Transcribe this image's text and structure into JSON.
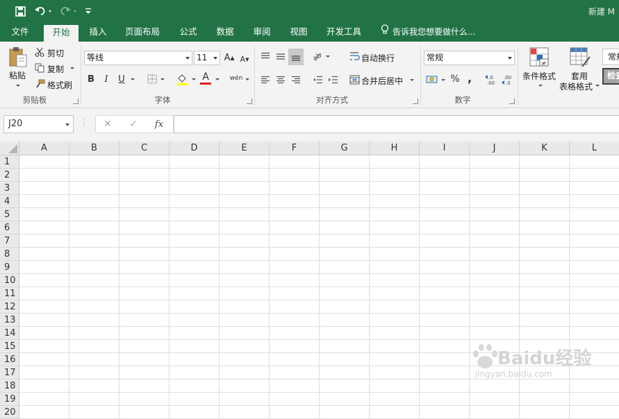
{
  "colors": {
    "brand": "#217346",
    "ribbon_bg": "#f3f3f3",
    "header_bg": "#e9e9e9"
  },
  "title_bar": {
    "title": "新建 M"
  },
  "tabs": [
    {
      "label": "文件",
      "active": false
    },
    {
      "label": "开始",
      "active": true
    },
    {
      "label": "插入",
      "active": false
    },
    {
      "label": "页面布局",
      "active": false
    },
    {
      "label": "公式",
      "active": false
    },
    {
      "label": "数据",
      "active": false
    },
    {
      "label": "审阅",
      "active": false
    },
    {
      "label": "视图",
      "active": false
    },
    {
      "label": "开发工具",
      "active": false
    }
  ],
  "tell_me": "告诉我您想要做什么...",
  "clipboard": {
    "paste": "粘贴",
    "cut": "剪切",
    "copy": "复制",
    "format_painter": "格式刷",
    "label": "剪贴板"
  },
  "font": {
    "name": "等线",
    "size": "11",
    "label": "字体",
    "bold": "B",
    "italic": "I",
    "underline": "U",
    "grow": "A",
    "shrink": "A",
    "font_color": "A",
    "phonetic": "wén"
  },
  "alignment": {
    "wrap_text": "自动换行",
    "merge_center": "合并后居中",
    "label": "对齐方式"
  },
  "number": {
    "format": "常规",
    "percent": "%",
    "comma": ",",
    "label": "数字"
  },
  "styles": {
    "conditional": "条件格式",
    "table_format_1": "套用",
    "table_format_2": "表格格式",
    "normal": "常规",
    "check": "检查"
  },
  "formula_bar": {
    "name_box": "J20",
    "cancel": "✕",
    "enter": "✓",
    "fx": "fx",
    "value": ""
  },
  "columns": [
    "A",
    "B",
    "C",
    "D",
    "E",
    "F",
    "G",
    "H",
    "I",
    "J",
    "K",
    "L"
  ],
  "rows": [
    "1",
    "2",
    "3",
    "4",
    "5",
    "6",
    "7",
    "8",
    "9",
    "10",
    "11",
    "12",
    "13",
    "14",
    "15",
    "16",
    "17",
    "18",
    "19",
    "20"
  ],
  "watermark": {
    "brand": "Baidu经验",
    "url": "jingyan.baidu.com"
  },
  "icons": [
    "save-icon",
    "undo-icon",
    "redo-icon",
    "customize-qat-icon",
    "lightbulb-icon",
    "paste-icon",
    "cut-icon",
    "copy-icon",
    "format-painter-icon",
    "border-icon",
    "fill-color-icon",
    "align-icon",
    "orientation-icon",
    "wrap-icon",
    "merge-icon",
    "currency-icon",
    "decimal-icon",
    "conditional-format-icon",
    "table-format-icon"
  ]
}
